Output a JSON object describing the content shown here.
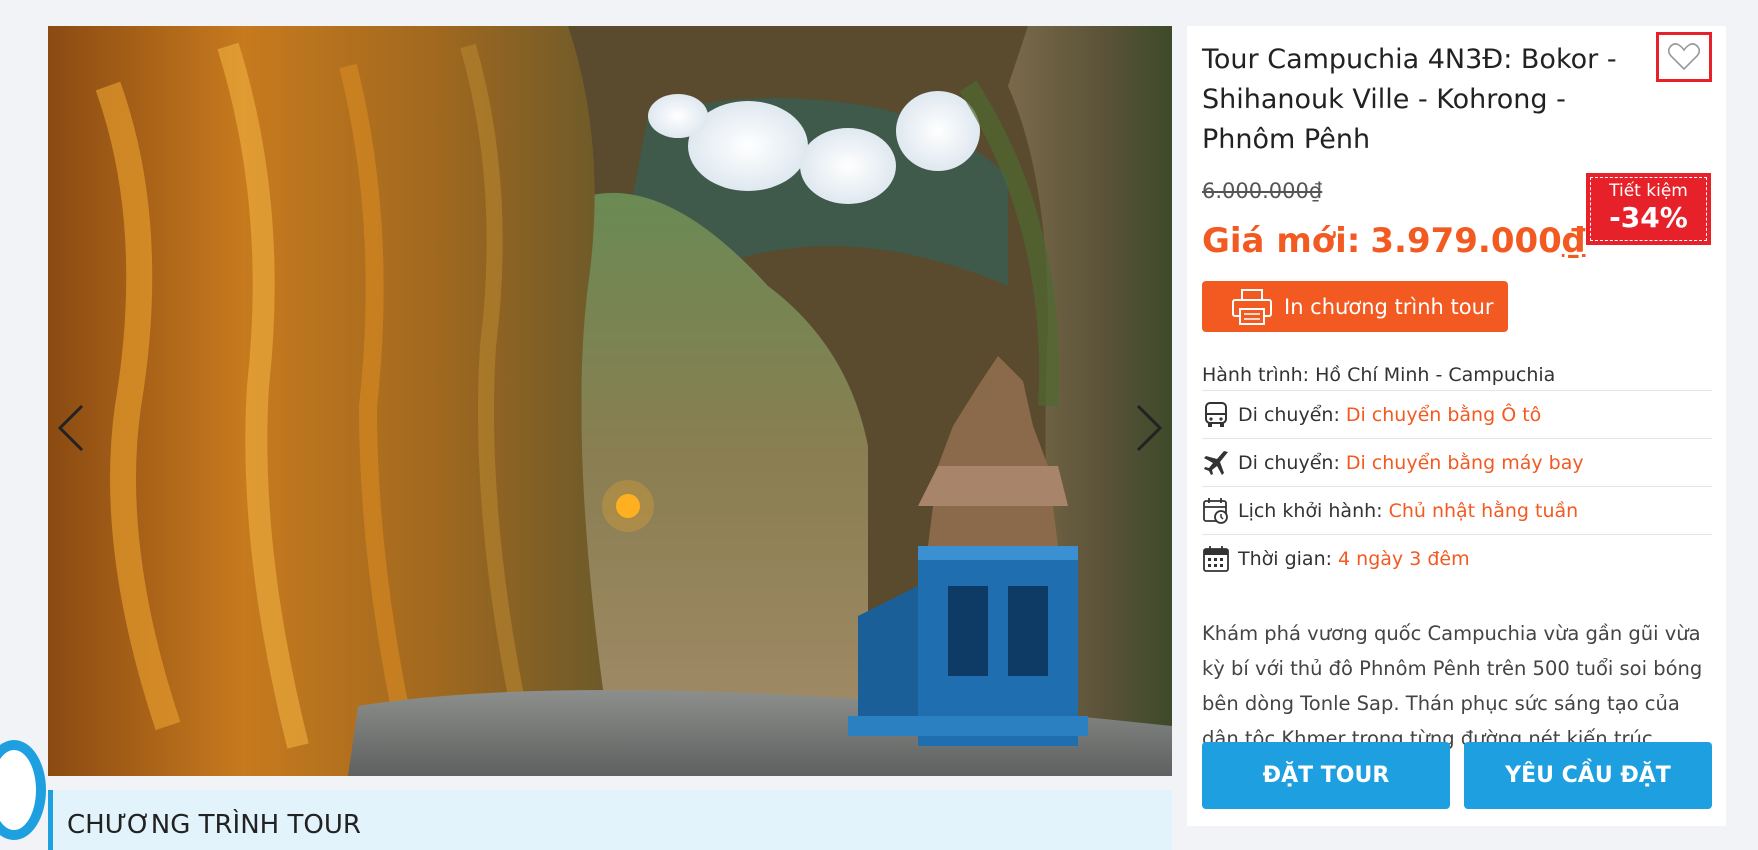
{
  "gallery": {
    "image_alt": "Batu cave temple",
    "prev_icon": "chevron-left-icon",
    "next_icon": "chevron-right-icon"
  },
  "tour": {
    "title": "Tour Campuchia 4N3Đ: Bokor - Shihanouk Ville - Kohrong - Phnôm Pênh",
    "favorite_icon": "heart-icon",
    "old_price": "6.000.000₫",
    "new_price_label": "Giá mới:",
    "new_price_value": "3.979.000",
    "currency_symbol": "₫",
    "save_label": "Tiết kiệm",
    "save_percent": "-34%",
    "print_label": "In chương trình tour",
    "route": "Hành trình: Hồ Chí Minh - Campuchia",
    "info": [
      {
        "icon": "bus-icon",
        "key": "Di chuyển:",
        "value": "Di chuyển bằng Ô tô"
      },
      {
        "icon": "airplane-icon",
        "key": "Di chuyển:",
        "value": "Di chuyển bằng máy bay"
      },
      {
        "icon": "calendar-clock-icon",
        "key": "Lịch khởi hành:",
        "value": "Chủ nhật hằng tuần"
      },
      {
        "icon": "calendar-icon",
        "key": "Thời gian:",
        "value": "4 ngày 3 đêm"
      }
    ],
    "description": "Khám phá vương quốc Campuchia vừa gần gũi vừa kỳ bí với thủ đô Phnôm Pênh trên 500 tuổi soi bóng bên dòng Tonle Sap. Thán phục sức sáng tạo của dân tộc Khmer trong từng đường nét kiến trúc...",
    "book_label": "ĐẶT TOUR",
    "request_label": "YÊU CẦU ĐẶT"
  },
  "section": {
    "program_title": "CHƯƠNG TRÌNH TOUR"
  },
  "colors": {
    "accent_orange": "#f25a22",
    "accent_blue": "#1e9fe0",
    "badge_red": "#e62129"
  }
}
